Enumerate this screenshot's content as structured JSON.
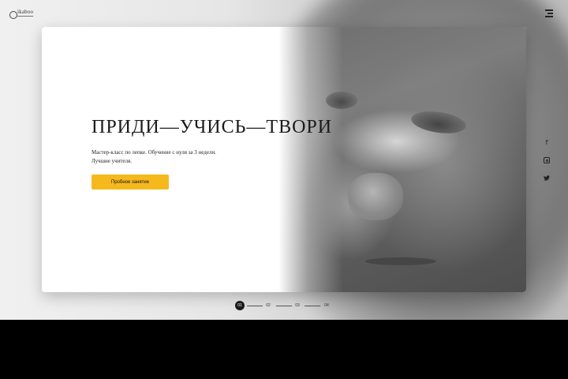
{
  "brand": {
    "name": "ikaboo"
  },
  "hero": {
    "headline": "ПРИДИ—УЧИСЬ—ТВОРИ",
    "description_lines": [
      "Мастер-класс по лепке. Обучение с нуля за 3 недели.",
      "Лучшие учителя."
    ],
    "cta_label": "Пробное занятие"
  },
  "pagination": {
    "items": [
      "01",
      "02",
      "03",
      "04"
    ],
    "active": "01"
  },
  "social": [
    "facebook-icon",
    "instagram-icon",
    "twitter-icon"
  ],
  "colors": {
    "accent": "#f5b91e",
    "text": "#1a1a1a",
    "background": "#e6e6e6",
    "card": "#ffffff"
  }
}
